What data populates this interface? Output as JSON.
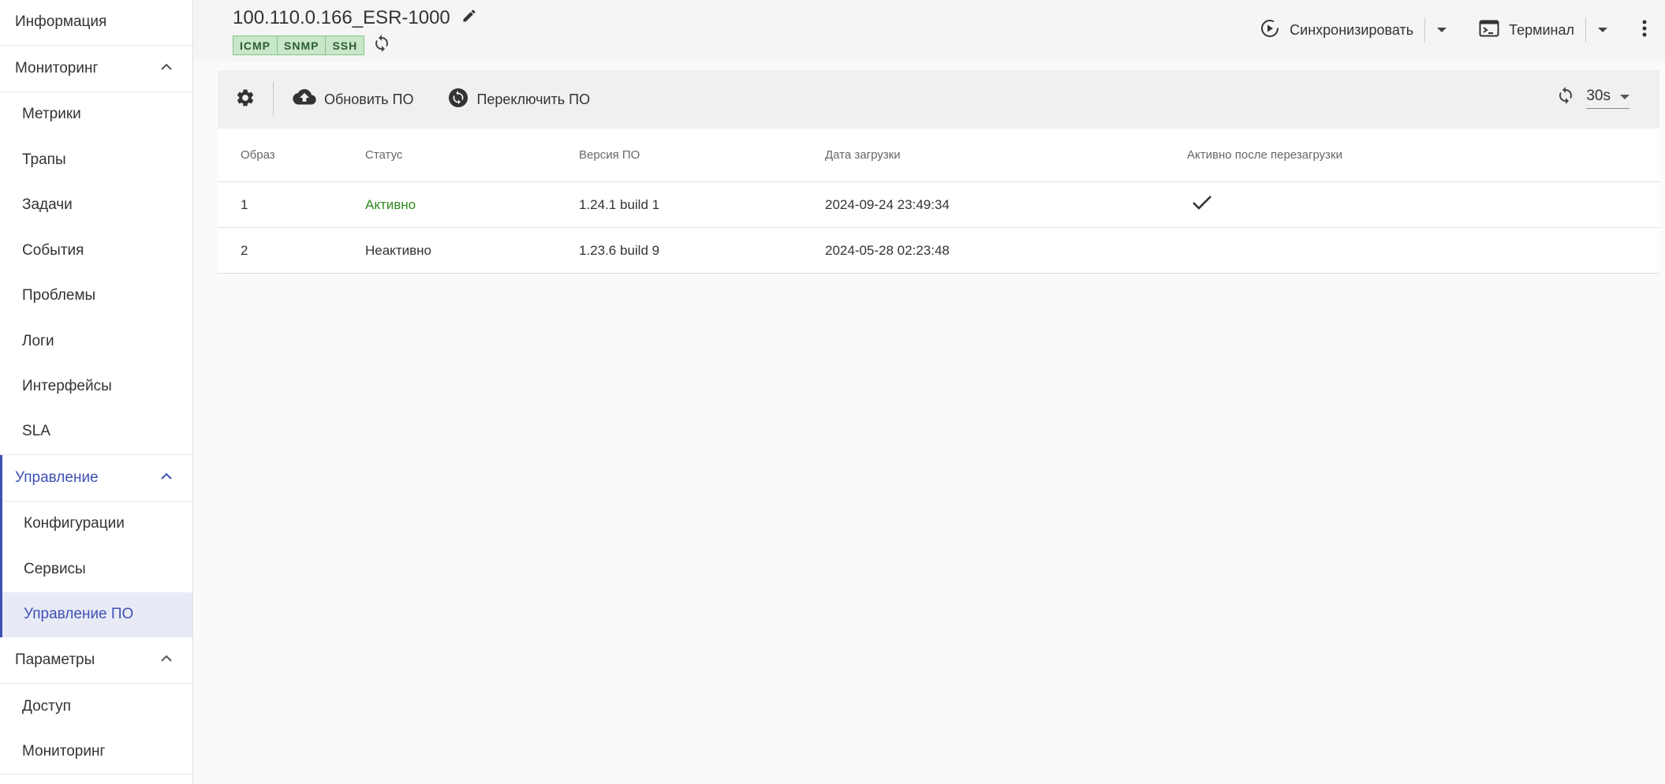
{
  "sidebar": {
    "info": "Информация",
    "monitoring_group": "Мониторинг",
    "monitoring_items": [
      "Метрики",
      "Трапы",
      "Задачи",
      "События",
      "Проблемы",
      "Логи",
      "Интерфейсы",
      "SLA"
    ],
    "management_group": "Управление",
    "management_items": [
      "Конфигурации",
      "Сервисы",
      "Управление ПО"
    ],
    "params_group": "Параметры",
    "params_items": [
      "Доступ",
      "Мониторинг"
    ]
  },
  "header": {
    "device_title": "100.110.0.166_ESR-1000",
    "tags": [
      "ICMP",
      "SNMP",
      "SSH"
    ],
    "sync_label": "Синхронизировать",
    "terminal_label": "Терминал"
  },
  "toolbar": {
    "update_label": "Обновить ПО",
    "switch_label": "Переключить ПО",
    "refresh_interval": "30s"
  },
  "table": {
    "columns": [
      "Образ",
      "Статус",
      "Версия ПО",
      "Дата загрузки",
      "Активно после перезагрузки"
    ],
    "rows": [
      {
        "image": "1",
        "status": "Активно",
        "version": "1.24.1 build 1",
        "date": "2024-09-24 23:49:34",
        "active_after_reboot": true
      },
      {
        "image": "2",
        "status": "Неактивно",
        "version": "1.23.6 build 9",
        "date": "2024-05-28 02:23:48",
        "active_after_reboot": false
      }
    ]
  },
  "colors": {
    "accent": "#3f51b5",
    "active_status": "#2e8b1e",
    "tag_bg": "#c8e6c9"
  }
}
